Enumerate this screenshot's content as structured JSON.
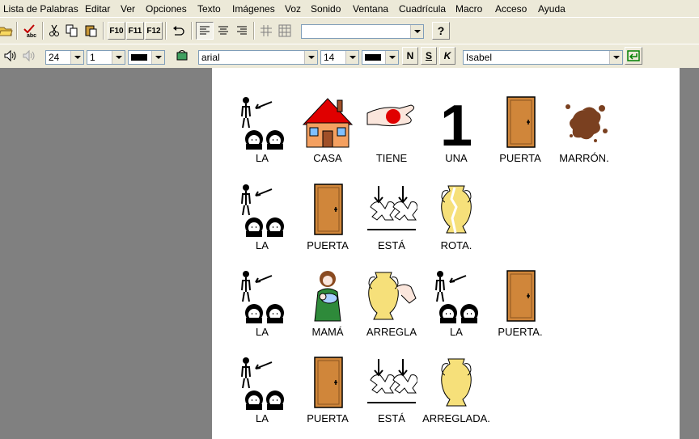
{
  "menu": [
    "Lista de Palabras",
    "Editar",
    "Ver",
    "Opciones",
    "Texto",
    "Imágenes",
    "Voz",
    "Sonido",
    "Ventana",
    "Cuadrícula",
    "Macro",
    "Acceso",
    "Ayuda"
  ],
  "toolbar": {
    "f10": "F10",
    "f11": "F11",
    "f12": "F12",
    "combo_empty": "",
    "help": "?"
  },
  "format_bar": {
    "size_value": "24",
    "line_value": "1",
    "font_value": "arial",
    "font_size_value": "14",
    "bold_label": "N",
    "underline_label": "S",
    "italic_label": "K",
    "voice_value": "Isabel"
  },
  "rows": [
    [
      {
        "icon": "people-pointer-icon",
        "label": "LA"
      },
      {
        "icon": "house-icon",
        "label": "CASA"
      },
      {
        "icon": "hand-holding-icon",
        "label": "TIENE"
      },
      {
        "icon": "number-one-icon",
        "label": "UNA",
        "glyph": "1"
      },
      {
        "icon": "door-icon",
        "label": "PUERTA"
      },
      {
        "icon": "brown-stain-icon",
        "label": "MARRÓN."
      }
    ],
    [
      {
        "icon": "people-pointer-icon",
        "label": "LA"
      },
      {
        "icon": "door-icon",
        "label": "PUERTA"
      },
      {
        "icon": "hands-down-icon",
        "label": "ESTÁ"
      },
      {
        "icon": "broken-vase-icon",
        "label": "ROTA."
      }
    ],
    [
      {
        "icon": "people-pointer-icon",
        "label": "LA"
      },
      {
        "icon": "mother-baby-icon",
        "label": "MAMÁ"
      },
      {
        "icon": "vase-repair-icon",
        "label": "ARREGLA"
      },
      {
        "icon": "people-pointer-icon",
        "label": "LA"
      },
      {
        "icon": "door-icon",
        "label": "PUERTA."
      }
    ],
    [
      {
        "icon": "people-pointer-icon",
        "label": "LA"
      },
      {
        "icon": "door-icon",
        "label": "PUERTA"
      },
      {
        "icon": "hands-down-icon",
        "label": "ESTÁ"
      },
      {
        "icon": "vase-icon",
        "label": "ARREGLADA."
      }
    ]
  ]
}
